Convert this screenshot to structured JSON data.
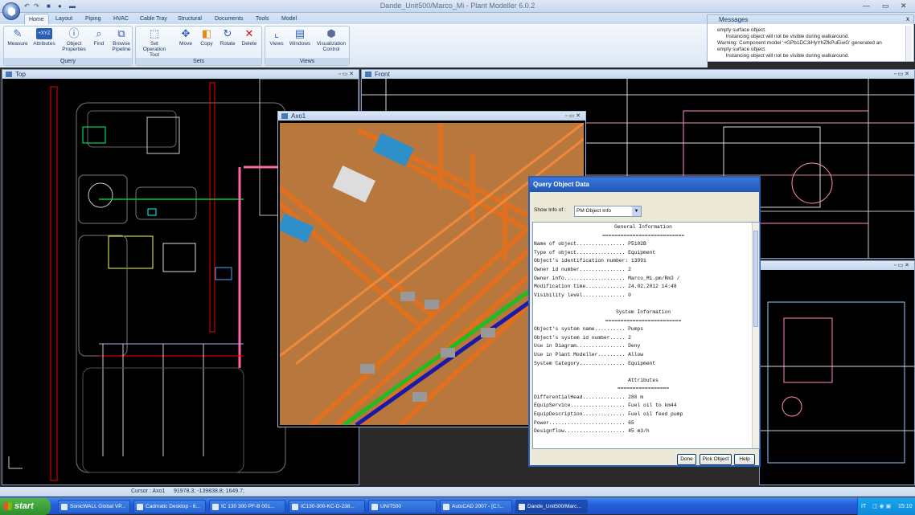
{
  "window": {
    "title": "Dande_Unit500/Marco_Mi - Plant Modeller 6.0.2",
    "help": "?",
    "minimize": "—",
    "maximize": "▭",
    "close": "✕"
  },
  "tabs": [
    "Home",
    "Layout",
    "Piping",
    "HVAC",
    "Cable Tray",
    "Structural",
    "Documents",
    "Tools",
    "Model"
  ],
  "ribbon": {
    "groups": [
      {
        "label": "Query",
        "buttons": [
          "Measure",
          "Attributes",
          "Object Properties",
          "Find",
          "Browse Pipeline"
        ]
      },
      {
        "label": "Sets",
        "buttons": [
          "Set Operation Tool",
          "Move",
          "Copy",
          "Rotate",
          "Delete"
        ]
      },
      {
        "label": "Views",
        "buttons": [
          "Views",
          "Windows",
          "Visualization Control"
        ]
      }
    ],
    "xyz_badge": "+XYZ"
  },
  "messages": {
    "title": "Messages",
    "close": "x",
    "lines": [
      "empty surface object.",
      "      Instancing object will not be visible during walkaround.",
      "Warning: Component model '+GPb1DC3iHyYhZfkPuEiwG' generated an",
      "empty surface object.",
      "      Instancing object will not be visible during walkaround."
    ]
  },
  "panes": {
    "top": {
      "title": "Top",
      "controls": "▫  ▭  ✕"
    },
    "front": {
      "title": "Front",
      "controls": "▫  ▭  ✕"
    },
    "axo": {
      "title": "Axo1",
      "controls": "▫  ▭  ✕"
    },
    "fourth": {
      "controls": "▫  ▭  ✕"
    }
  },
  "dialog": {
    "title": "Query Object Data",
    "show_label": "Show Info of :",
    "show_value": "PM Object Info",
    "lines": [
      {
        "t": "General Information",
        "c": true
      },
      {
        "t": "===========================",
        "c": true
      },
      {
        "t": "Name of object................ P5102B"
      },
      {
        "t": "Type of object................ Equipment"
      },
      {
        "t": "Object's identification number: 13991"
      },
      {
        "t": "Owner id number............... 2"
      },
      {
        "t": "Owner info.................... Marco_Mi.pm/Rm3 /"
      },
      {
        "t": "Modification time............. 24.02.2012 14:48"
      },
      {
        "t": "Visibility level.............. 0"
      },
      {
        "t": "",
        "c": true
      },
      {
        "t": "System Information",
        "c": true
      },
      {
        "t": "=========================",
        "c": true
      },
      {
        "t": "Object's system name.......... Pumps"
      },
      {
        "t": "Object's system id number..... 2"
      },
      {
        "t": "Use in Diagram................ Deny"
      },
      {
        "t": "Use in Plant Modeller......... Allow"
      },
      {
        "t": "System Category............... Equipment"
      },
      {
        "t": "",
        "c": true
      },
      {
        "t": "Attributes",
        "c": true
      },
      {
        "t": "=================",
        "c": true
      },
      {
        "t": "DifferentialHead.............. 280 m"
      },
      {
        "t": "EquipService.................. Fuel oil to km44"
      },
      {
        "t": "EquipDescription.............. Fuel oil feed pump"
      },
      {
        "t": "Power......................... 65"
      },
      {
        "t": "Designflow.................... 45 m3/h"
      }
    ],
    "buttons": {
      "done": "Done",
      "pick": "Pick Object",
      "help": "Help"
    }
  },
  "status": {
    "cursor_label": "Cursor : Axo1",
    "coords": "91978.3; -139838.8; 1649.7;"
  },
  "taskbar": {
    "start": "start",
    "tasks": [
      "SonicWALL Global VP...",
      "Cadmatic Desktop - 6...",
      "IC 130 300 PF-B 001...",
      "IC130-300-KC-D-238...",
      "UNIT500",
      "AutoCAD 2007 - [C:\\...",
      "Dande_Unit500/Marc..."
    ],
    "tray_lang": "IT",
    "clock": "15:10"
  },
  "colors": {
    "pipe_orange": "#e0701e",
    "floor_brown": "#b8773c",
    "dialog_border": "#2b5fb5",
    "taskbar_blue": "#245edc"
  }
}
